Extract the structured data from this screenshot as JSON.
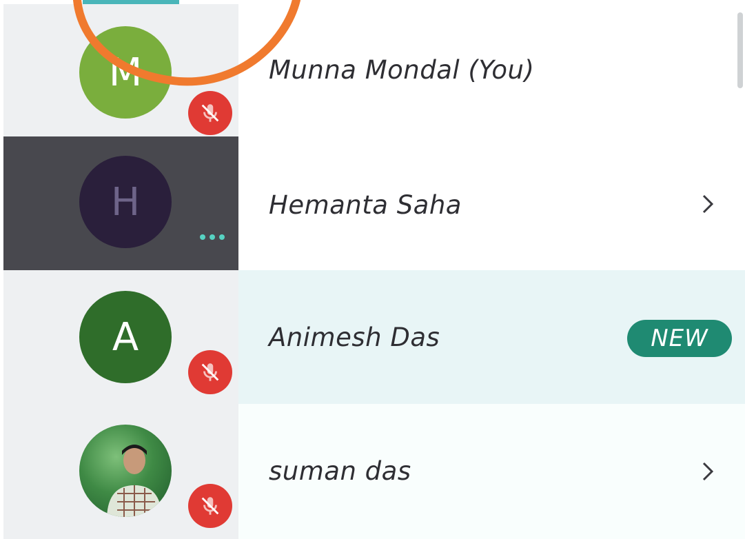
{
  "participants": [
    {
      "name": "Munna Mondal (You)",
      "initial": "M",
      "avatar_color": "#7aae3d",
      "muted": true,
      "icon": "mic-off-icon"
    },
    {
      "name": "Hemanta Saha",
      "initial": "H",
      "avatar_color": "#2a1f3b",
      "status": "more-options",
      "icon": "chevron-right-icon"
    },
    {
      "name": "Animesh Das",
      "initial": "A",
      "avatar_color": "#2f6d2a",
      "muted": true,
      "badge": "NEW"
    },
    {
      "name": "suman das",
      "avatar": "profile-photo",
      "muted": true,
      "icon": "chevron-right-icon"
    }
  ],
  "colors": {
    "mute_badge": "#e03a34",
    "new_badge": "#1f8a72",
    "accent": "#49b5b9",
    "highlight_row": "#e8f5f6",
    "annotation_ring": "#f07a2e"
  }
}
